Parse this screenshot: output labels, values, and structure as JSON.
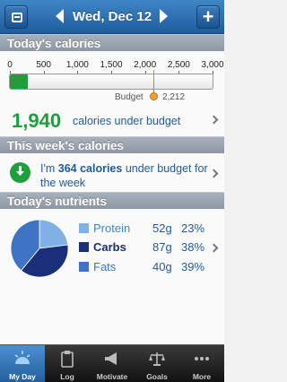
{
  "header": {
    "date": "Wed, Dec 12"
  },
  "sections": {
    "today_calories": "Today's calories",
    "week_calories": "This week's calories",
    "today_nutrients": "Today's nutrients"
  },
  "calories": {
    "scale_labels": [
      "0",
      "500",
      "1,000",
      "1,500",
      "2,000",
      "2,500",
      "3,000"
    ],
    "consumed": 272,
    "scale_max": 3000,
    "budget_label": "Budget",
    "budget_value": "2,212",
    "under_number": "1,940",
    "under_text": "calories under budget",
    "fill_color": "#1e9e3c"
  },
  "week": {
    "prefix": "I'm ",
    "amount": "364",
    "middle": " calories",
    "suffix": " under budget for the week"
  },
  "nutrients": [
    {
      "name": "Protein",
      "grams": "52g",
      "percent": "23%",
      "value": 23,
      "color": "#7fb0e6",
      "name_color": "#3f86c6"
    },
    {
      "name": "Carbs",
      "grams": "87g",
      "percent": "38%",
      "value": 38,
      "color": "#1a2f7a",
      "name_color": "#1a2f7a"
    },
    {
      "name": "Fats",
      "grams": "40g",
      "percent": "39%",
      "value": 39,
      "color": "#3f74c5",
      "name_color": "#3f74c5"
    }
  ],
  "tabs": [
    {
      "label": "My Day",
      "icon": "sun-icon",
      "active": true
    },
    {
      "label": "Log",
      "icon": "clipboard-icon",
      "active": false
    },
    {
      "label": "Motivate",
      "icon": "megaphone-icon",
      "active": false
    },
    {
      "label": "Goals",
      "icon": "scale-icon",
      "active": false
    },
    {
      "label": "More",
      "icon": "more-dots-icon",
      "active": false
    }
  ]
}
